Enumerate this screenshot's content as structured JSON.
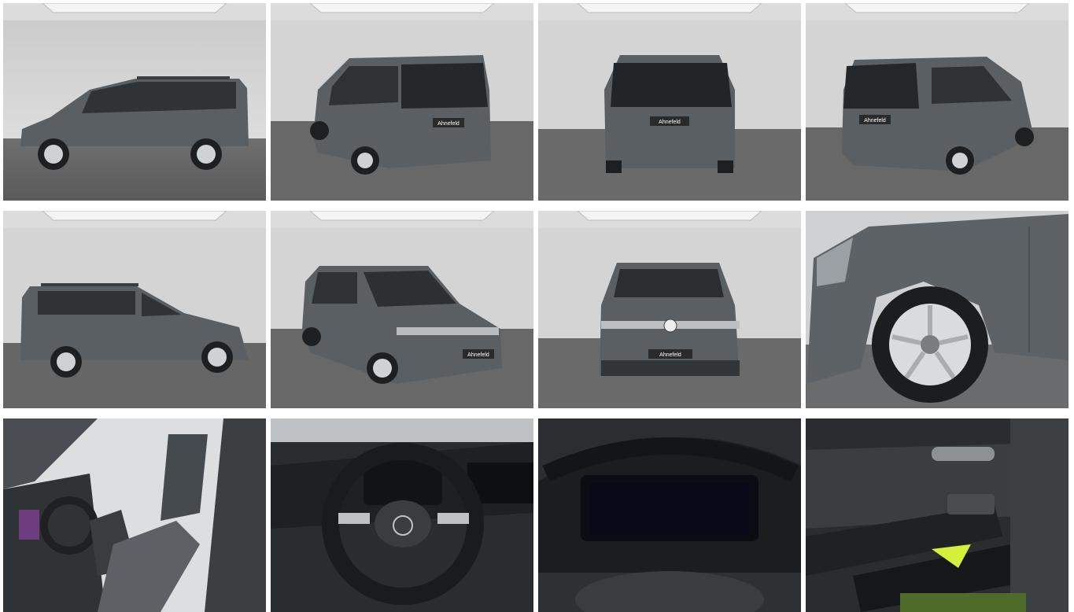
{
  "gallery": {
    "dealer_badge": "Ahnefeld",
    "car_color": "#5a5f63",
    "photos": [
      {
        "view": "side-left",
        "kind": "studio"
      },
      {
        "view": "rear-three-quarter-left",
        "kind": "studio"
      },
      {
        "view": "rear",
        "kind": "studio"
      },
      {
        "view": "rear-three-quarter-right",
        "kind": "studio"
      },
      {
        "view": "side-right",
        "kind": "studio"
      },
      {
        "view": "front-three-quarter-right",
        "kind": "studio"
      },
      {
        "view": "front",
        "kind": "studio"
      },
      {
        "view": "wheel-detail",
        "kind": "detail"
      },
      {
        "view": "front-seats",
        "kind": "interior"
      },
      {
        "view": "steering-wheel",
        "kind": "interior"
      },
      {
        "view": "digital-cockpit",
        "kind": "interior"
      },
      {
        "view": "door-panel",
        "kind": "interior"
      }
    ]
  }
}
